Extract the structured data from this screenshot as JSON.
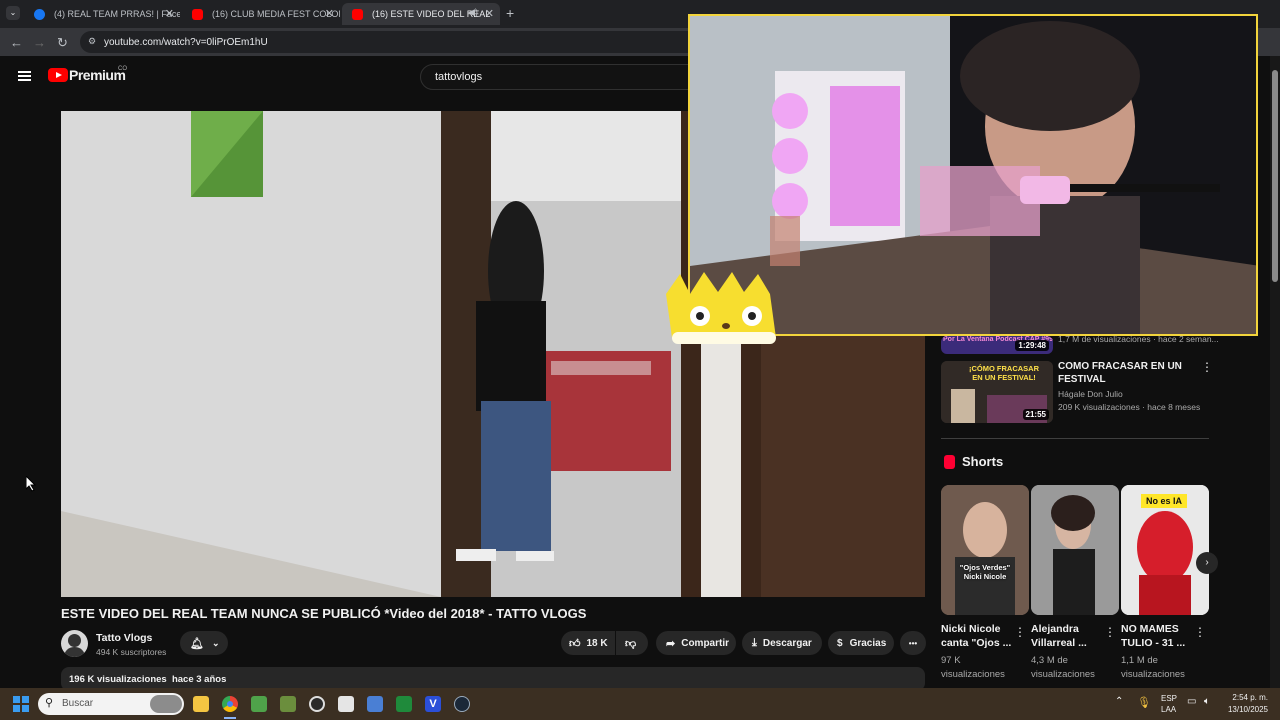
{
  "browser": {
    "tabs": [
      {
        "title": "(4) REAL TEAM PRRAS! | Facebo",
        "favicon": "facebook-icon"
      },
      {
        "title": "(16) CLUB MEDIA FEST COLOM",
        "favicon": "youtube-icon"
      },
      {
        "title": "(16) ESTE VIDEO DEL REAL",
        "favicon": "youtube-icon"
      }
    ],
    "url": "youtube.com/watch?v=0liPrOEm1hU"
  },
  "youtube": {
    "logo_text": "Premium",
    "country_code": "CO",
    "search_value": "tattovlogs"
  },
  "video": {
    "title": "ESTE VIDEO DEL REAL TEAM NUNCA SE PUBLICÓ *Video del 2018* - TATTO VLOGS",
    "channel_name": "Tatto Vlogs",
    "subscribers": "494 K suscriptores",
    "likes": "18 K",
    "share_label": "Compartir",
    "download_label": "Descargar",
    "thanks_label": "Gracias",
    "more_label": "•••",
    "description_meta": "196 K visualizaciones  hace 3 años"
  },
  "sidebar": {
    "videos": [
      {
        "title": "",
        "channel": "",
        "meta": "1,7 M de visualizaciones · hace 2 seman...",
        "duration": "1:29:48",
        "thumb_text": "Por La Ventana Podcast CAP #99 \"EDWAR\""
      },
      {
        "title": "COMO FRACASAR EN UN FESTIVAL",
        "channel": "Hágale Don Julio",
        "meta": "209 K visualizaciones · hace 8 meses",
        "duration": "21:55",
        "thumb_text": "¡CÓMO FRACASAR EN UN FESTIVAL!"
      }
    ],
    "shorts_heading": "Shorts",
    "shorts": [
      {
        "title": "Nicki Nicole canta \"Ojos ...",
        "views": "97 K visualizaciones",
        "thumb_text": "\"Ojos Verdes\" Nicki Nicole"
      },
      {
        "title": "Alejandra Villarreal ...",
        "views": "4,3 M de visualizaciones",
        "thumb_text": ""
      },
      {
        "title": "NO MAMES TULIO - 31 ...",
        "views": "1,1 M de visualizaciones",
        "thumb_text": "No es IA"
      }
    ]
  },
  "taskbar": {
    "search_placeholder": "Buscar",
    "lang_top": "ESP",
    "lang_bottom": "LAA",
    "time": "2:54 p. m.",
    "date": "13/10/2025"
  },
  "colors": {
    "yt_red": "#ff0000",
    "overlay_border": "#f2d43c",
    "taskbar": "#3b2f22"
  }
}
